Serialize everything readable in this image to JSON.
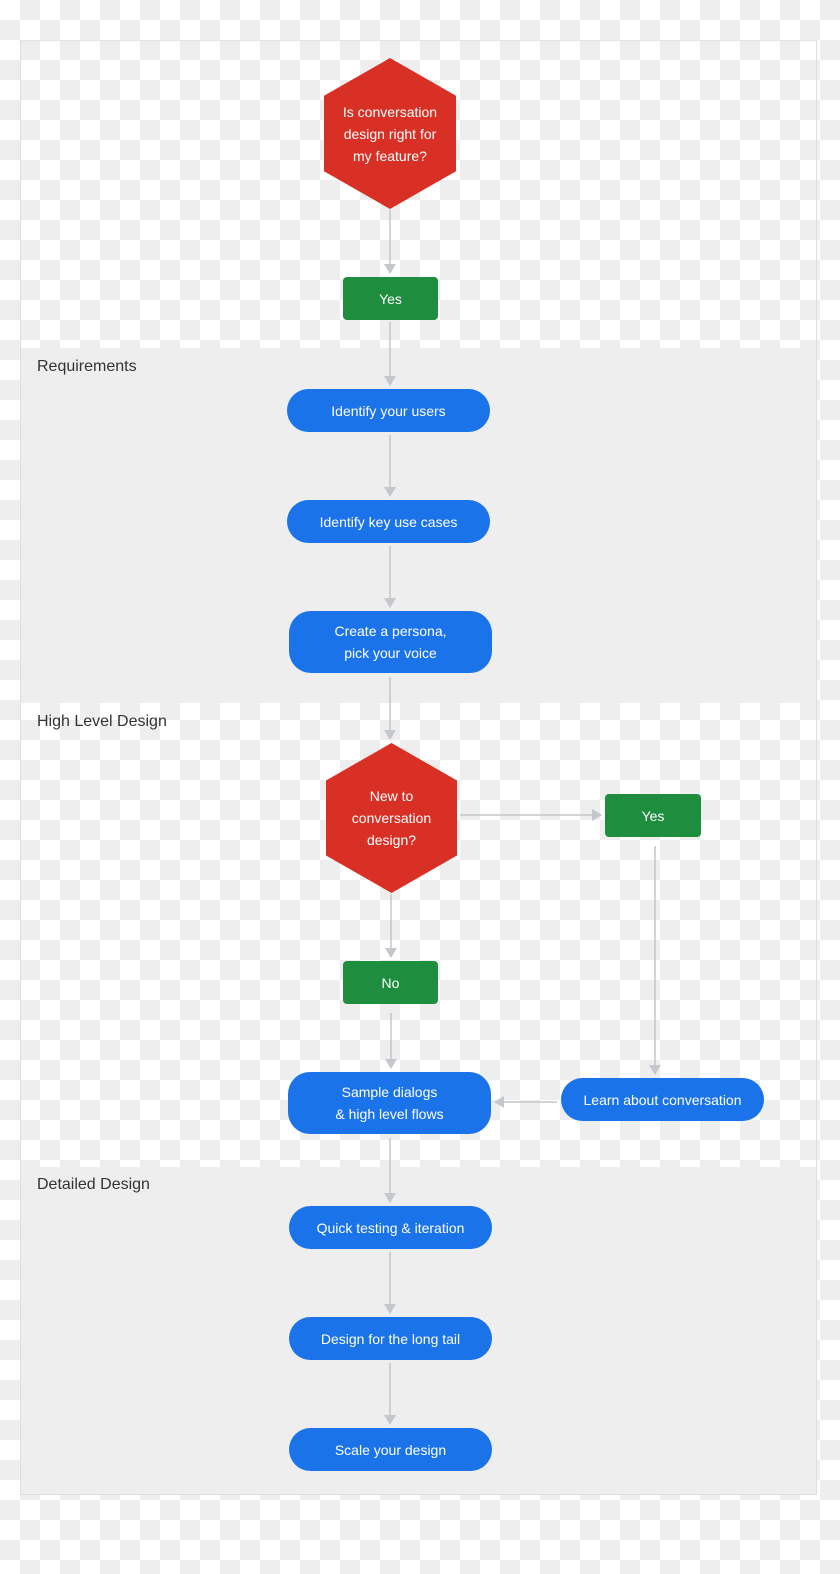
{
  "diagram": {
    "colors": {
      "decision": "#d93025",
      "answer": "#1e8e3e",
      "process": "#1a73e8",
      "connector": "#c4c7cc",
      "band": "#eeeeee",
      "label_text": "#333333"
    },
    "sections": [
      {
        "id": "requirements",
        "label": "Requirements"
      },
      {
        "id": "high-level-design",
        "label": "High Level Design"
      },
      {
        "id": "detailed-design",
        "label": "Detailed Design"
      }
    ],
    "nodes": {
      "q1": {
        "type": "decision",
        "text": "Is conversation\ndesign right for\nmy feature?"
      },
      "yes1": {
        "type": "answer",
        "text": "Yes"
      },
      "identify_users": {
        "type": "process",
        "text": "Identify your users"
      },
      "key_use_cases": {
        "type": "process",
        "text": "Identify key use cases"
      },
      "persona": {
        "type": "process",
        "text": "Create a persona,\npick your voice"
      },
      "q2": {
        "type": "decision",
        "text": "New to\nconversation\ndesign?"
      },
      "yes2": {
        "type": "answer",
        "text": "Yes"
      },
      "no": {
        "type": "answer",
        "text": "No"
      },
      "sample_dialogs": {
        "type": "process",
        "text": "Sample dialogs\n& high level flows"
      },
      "learn": {
        "type": "process",
        "text": "Learn about conversation"
      },
      "quick_testing": {
        "type": "process",
        "text": "Quick testing & iteration"
      },
      "long_tail": {
        "type": "process",
        "text": "Design for the long tail"
      },
      "scale": {
        "type": "process",
        "text": "Scale your design"
      }
    },
    "edges": [
      {
        "from": "q1",
        "to": "yes1"
      },
      {
        "from": "yes1",
        "to": "identify_users"
      },
      {
        "from": "identify_users",
        "to": "key_use_cases"
      },
      {
        "from": "key_use_cases",
        "to": "persona"
      },
      {
        "from": "persona",
        "to": "q2"
      },
      {
        "from": "q2",
        "to": "yes2"
      },
      {
        "from": "q2",
        "to": "no"
      },
      {
        "from": "no",
        "to": "sample_dialogs"
      },
      {
        "from": "yes2",
        "to": "learn"
      },
      {
        "from": "learn",
        "to": "sample_dialogs"
      },
      {
        "from": "sample_dialogs",
        "to": "quick_testing"
      },
      {
        "from": "quick_testing",
        "to": "long_tail"
      },
      {
        "from": "long_tail",
        "to": "scale"
      }
    ]
  }
}
